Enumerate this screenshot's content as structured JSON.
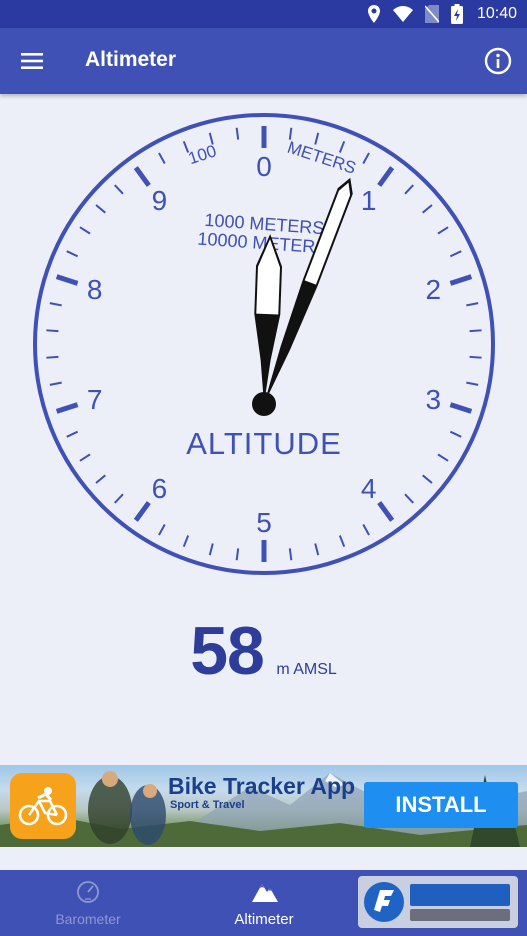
{
  "status_bar": {
    "time": "10:40",
    "icons": [
      "location-icon",
      "wifi-icon",
      "no-sim-icon",
      "battery-icon"
    ]
  },
  "app_bar": {
    "title": "Altimeter",
    "menu_icon": "hamburger-menu-icon",
    "info_icon": "info-icon"
  },
  "gauge": {
    "dial_numbers": [
      "0",
      "1",
      "2",
      "3",
      "4",
      "5",
      "6",
      "7",
      "8",
      "9"
    ],
    "label_100": "100",
    "label_meters": "METERS",
    "label_1000": "1000 METERS",
    "label_10000": "10000 METERS",
    "label_altitude": "ALTITUDE",
    "long_hand_value": 0.58,
    "short_hand_value": 0.058,
    "color": "#3f51b5"
  },
  "reading": {
    "value": "58",
    "unit": "m AMSL"
  },
  "ad": {
    "title": "Bike Tracker App",
    "subtitle": "Sport & Travel",
    "install_label": "INSTALL",
    "app_icon": "cyclist-icon"
  },
  "bottom_nav": {
    "items": [
      {
        "label": "Barometer",
        "icon": "gauge-icon",
        "active": false
      },
      {
        "label": "Altimeter",
        "icon": "mountain-icon",
        "active": true
      }
    ]
  },
  "colors": {
    "primary": "#3f51b5",
    "primary_dark": "#2a3aa0",
    "background": "#eceef8",
    "reading_text": "#2e3d9a",
    "ad_button": "#1e8ef0"
  }
}
